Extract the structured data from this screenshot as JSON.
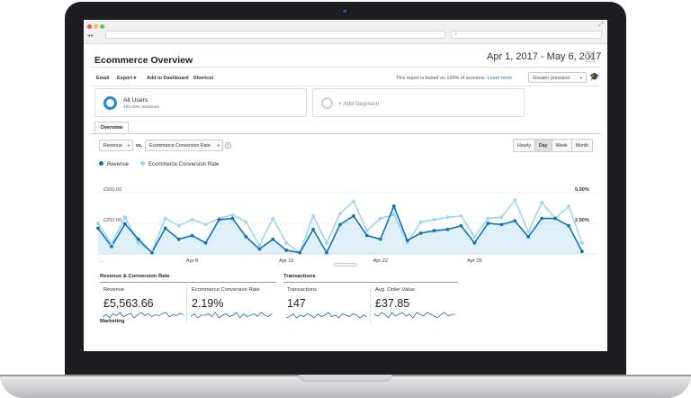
{
  "colors": {
    "revenue": "#0f73b9",
    "revenue_fill": "rgba(64,160,220,0.16)",
    "conversion": "#9fd5f0",
    "ring_all_users": "#1a8cd8",
    "ring_add_segment": "#cfcfcf"
  },
  "browser": {
    "nav_icons": [
      "back-arrow-icon",
      "forward-arrow-icon"
    ],
    "search_icon": "magnifier-icon"
  },
  "header": {
    "title": "Ecommerce Overview",
    "date_range": "Apr 1, 2017 - May 6, 2017",
    "date_caret": "▾"
  },
  "toolbar": {
    "email": "Email",
    "export": "Export ▾",
    "add_to_dashboard": "Add to Dashboard",
    "shortcut": "Shortcut",
    "sessions_note": "This report is based on 100% of sessions.",
    "learn_more": "Learn more",
    "precision": "Greater precision",
    "precision_caret": "▾",
    "cap_icon": "graduation-cap-icon"
  },
  "segments": {
    "all_users_title": "All Users",
    "all_users_sub": "100.00% Sessions",
    "add_segment": "+ Add Segment"
  },
  "tabs": {
    "overview": "Overview"
  },
  "controls": {
    "metric1": "Revenue",
    "vs": "vs.",
    "metric2": "Ecommerce Conversion Rate",
    "caret": "▾",
    "help": "?",
    "periods": [
      "Hourly",
      "Day",
      "Week",
      "Month"
    ],
    "active_period": "Day"
  },
  "legend": {
    "revenue": "Revenue",
    "conversion": "Ecommerce Conversion Rate"
  },
  "chart_data": {
    "type": "line",
    "x_ticks": [
      "Apr 8",
      "Apr 15",
      "Apr 22",
      "Apr 29"
    ],
    "left_axis_labels": [
      "£500.00",
      "£250.00"
    ],
    "right_axis_labels": [
      "5.00%",
      "2.50%"
    ],
    "left_ylim": [
      0,
      500
    ],
    "right_ylim": [
      0,
      5
    ],
    "series": [
      {
        "name": "Revenue",
        "values": [
          210,
          60,
          245,
          120,
          10,
          210,
          120,
          150,
          90,
          280,
          290,
          140,
          40,
          120,
          30,
          10,
          200,
          10,
          240,
          310,
          150,
          120,
          390,
          110,
          170,
          190,
          200,
          230,
          90,
          250,
          240,
          270,
          140,
          290,
          290,
          230,
          20
        ]
      },
      {
        "name": "Ecommerce Conversion Rate",
        "values": [
          2.5,
          0.8,
          3.0,
          0.9,
          0.2,
          2.9,
          2.3,
          2.8,
          2.4,
          2.9,
          3.2,
          2.6,
          0.7,
          2.9,
          0.9,
          0.1,
          3.1,
          0.9,
          3.3,
          4.3,
          1.9,
          2.9,
          3.2,
          0.9,
          2.6,
          2.8,
          3.0,
          3.1,
          1.4,
          2.9,
          3.0,
          4.4,
          1.8,
          4.2,
          2.9,
          3.9,
          0.9
        ]
      }
    ],
    "grid": true,
    "legend_position": "top-left"
  },
  "scorecards": {
    "group1_title": "Revenue & Conversion Rate",
    "group2_title": "Transactions",
    "cards": [
      {
        "label": "Revenue",
        "value": "£5,563.66"
      },
      {
        "label": "Ecommerce Conversion Rate",
        "value": "2.19%"
      },
      {
        "label": "Transactions",
        "value": "147"
      },
      {
        "label": "Avg. Order Value",
        "value": "£37.85"
      }
    ],
    "sparklines": [
      [
        3,
        5,
        2,
        6,
        4,
        7,
        3,
        5,
        6,
        2,
        5,
        7,
        4,
        6,
        3,
        5,
        4,
        6,
        7,
        3,
        5,
        4,
        6,
        5
      ],
      [
        4,
        6,
        3,
        5,
        5,
        6,
        4,
        7,
        3,
        5,
        6,
        4,
        5,
        7,
        3,
        6,
        4,
        5,
        6,
        4,
        7,
        5,
        4,
        6
      ],
      [
        3,
        4,
        6,
        3,
        5,
        4,
        6,
        5,
        3,
        6,
        4,
        5,
        7,
        4,
        5,
        3,
        6,
        5,
        4,
        6,
        5,
        3,
        5,
        4
      ],
      [
        5,
        4,
        6,
        5,
        3,
        6,
        4,
        5,
        6,
        4,
        5,
        3,
        6,
        5,
        4,
        6,
        5,
        4,
        3,
        5,
        6,
        4,
        5,
        5
      ]
    ]
  },
  "sections": {
    "marketing": "Marketing"
  }
}
